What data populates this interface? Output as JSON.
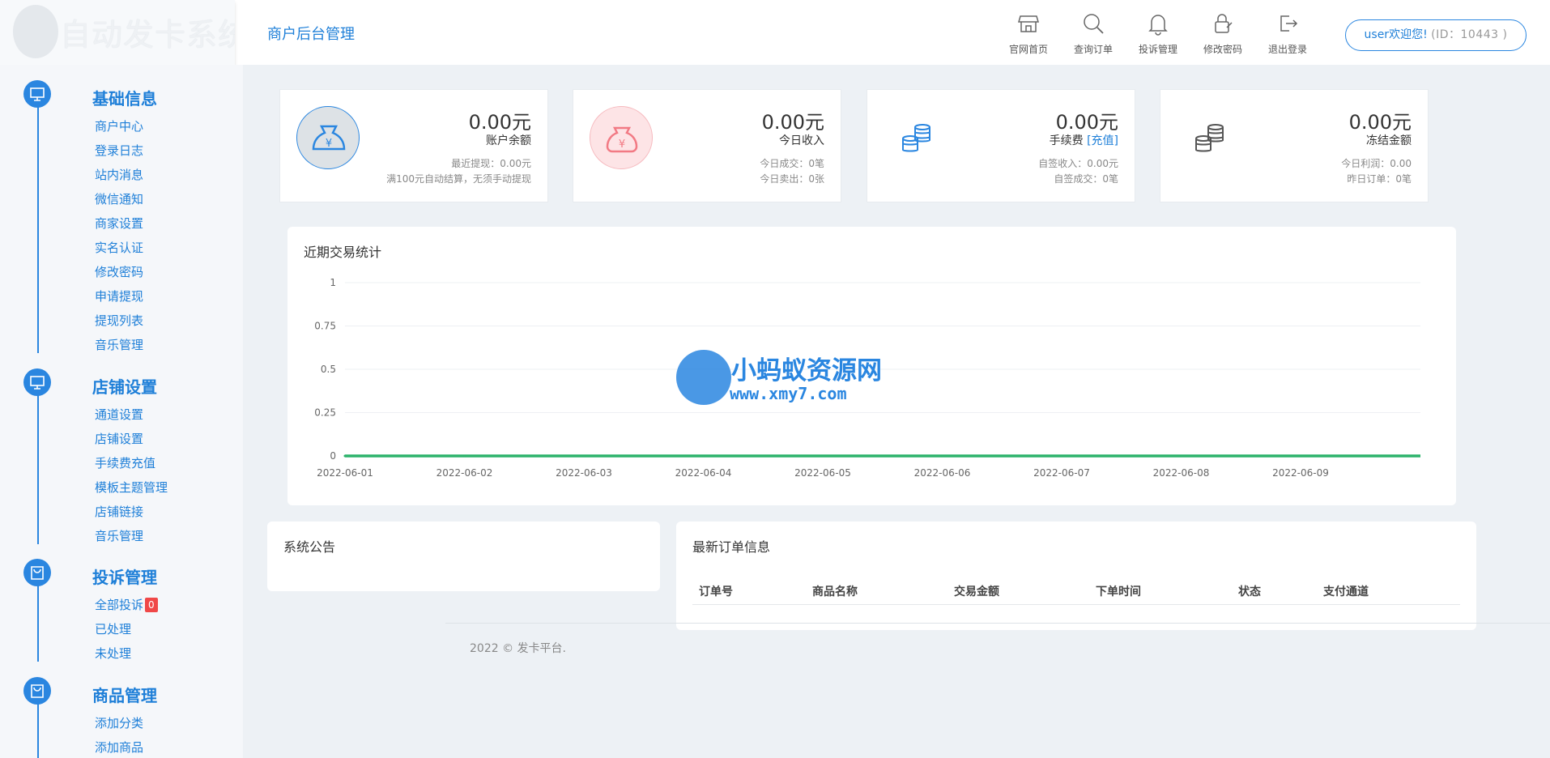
{
  "logo": {
    "text": "自动发卡系统"
  },
  "header": {
    "title": "商户后台管理",
    "nav": [
      {
        "label": "官网首页",
        "icon": "store-icon"
      },
      {
        "label": "查询订单",
        "icon": "search-icon"
      },
      {
        "label": "投诉管理",
        "icon": "bell-icon"
      },
      {
        "label": "修改密码",
        "icon": "lock-icon"
      },
      {
        "label": "退出登录",
        "icon": "logout-icon"
      }
    ],
    "user": {
      "greeting": "user欢迎您!",
      "id_text": "(ID：10443 )"
    }
  },
  "sidebar": {
    "sections": [
      {
        "title": "基础信息",
        "icon": "monitor-icon",
        "items": [
          "商户中心",
          "登录日志",
          "站内消息",
          "微信通知",
          "商家设置",
          "实名认证",
          "修改密码",
          "申请提现",
          "提现列表",
          "音乐管理"
        ]
      },
      {
        "title": "店铺设置",
        "icon": "monitor-icon",
        "items": [
          "通道设置",
          "店铺设置",
          "手续费充值",
          "模板主题管理",
          "店铺链接",
          "音乐管理"
        ]
      },
      {
        "title": "投诉管理",
        "icon": "bag-icon",
        "items": [
          "全部投诉",
          "已处理",
          "未处理"
        ],
        "badge": "0"
      },
      {
        "title": "商品管理",
        "icon": "bag-icon",
        "items": [
          "添加分类",
          "添加商品"
        ]
      }
    ]
  },
  "cards": [
    {
      "value": "0.00元",
      "label": "账户余额",
      "line1": "最近提现：0.00元",
      "line2": "满100元自动结算，无须手动提现",
      "icon": "money-bag-icon",
      "color": "#2a86e0"
    },
    {
      "value": "0.00元",
      "label": "今日收入",
      "line1": "今日成交：0笔",
      "line2": "今日卖出：0张",
      "icon": "money-pouch-icon",
      "color": "#f27a84"
    },
    {
      "value": "0.00元",
      "label": "手续费",
      "recharge": "[充值]",
      "line1": "自签收入：0.00元",
      "line2": "自签成交：0笔",
      "icon": "coins-icon",
      "color": "#2a86e0"
    },
    {
      "value": "0.00元",
      "label": "冻结金额",
      "line1": "今日利润：0.00",
      "line2": "昨日订单：0笔",
      "icon": "coins-icon",
      "color": "#555555"
    }
  ],
  "chart_title": "近期交易统计",
  "chart_data": {
    "type": "line",
    "title": "",
    "x": [
      "2022-06-01",
      "2022-06-02",
      "2022-06-03",
      "2022-06-04",
      "2022-06-05",
      "2022-06-06",
      "2022-06-07",
      "2022-06-08",
      "2022-06-09"
    ],
    "series": [
      {
        "values": [
          0,
          0,
          0,
          0,
          0,
          0,
          0,
          0,
          0
        ],
        "color": "#2db36b"
      }
    ],
    "yticks": [
      "0",
      "0.25",
      "0.5",
      "0.75",
      "1"
    ],
    "ylim": [
      0,
      1
    ],
    "grid": true
  },
  "watermark": {
    "title": "小蚂蚁资源网",
    "url": "www.xmy7.com"
  },
  "notice": {
    "title": "系统公告"
  },
  "orders": {
    "title": "最新订单信息",
    "columns": [
      "订单号",
      "商品名称",
      "交易金额",
      "下单时间",
      "状态",
      "支付通道"
    ]
  },
  "footer": {
    "text": "2022 © 发卡平台."
  }
}
